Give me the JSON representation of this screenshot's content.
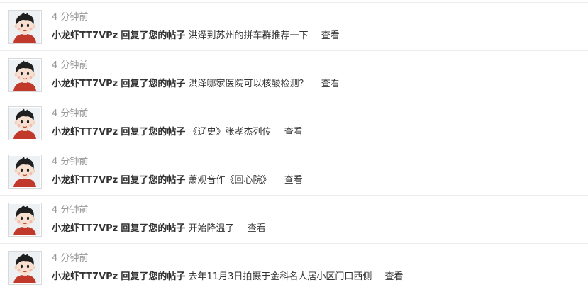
{
  "notifications": [
    {
      "time": "4 分钟前",
      "user": "小龙虾TT7VPz",
      "action": "回复了您的帖子",
      "thread": "洪泽到苏州的拼车群推荐一下",
      "view": "查看"
    },
    {
      "time": "4 分钟前",
      "user": "小龙虾TT7VPz",
      "action": "回复了您的帖子",
      "thread": "洪泽哪家医院可以核酸检测？",
      "view": "查看"
    },
    {
      "time": "4 分钟前",
      "user": "小龙虾TT7VPz",
      "action": "回复了您的帖子",
      "thread": "《辽史》张孝杰列传",
      "view": "查看"
    },
    {
      "time": "4 分钟前",
      "user": "小龙虾TT7VPz",
      "action": "回复了您的帖子",
      "thread": "萧观音作《回心院》",
      "view": "查看"
    },
    {
      "time": "4 分钟前",
      "user": "小龙虾TT7VPz",
      "action": "回复了您的帖子",
      "thread": "开始降温了",
      "view": "查看"
    },
    {
      "time": "4 分钟前",
      "user": "小龙虾TT7VPz",
      "action": "回复了您的帖子",
      "thread": "去年11月3日拍摄于金科名人居小区门口西侧",
      "view": "查看"
    }
  ],
  "avatar_icon": "cartoon-boy-avatar-icon",
  "colors": {
    "time": "#999999",
    "text": "#333333",
    "divider": "#ececec"
  }
}
